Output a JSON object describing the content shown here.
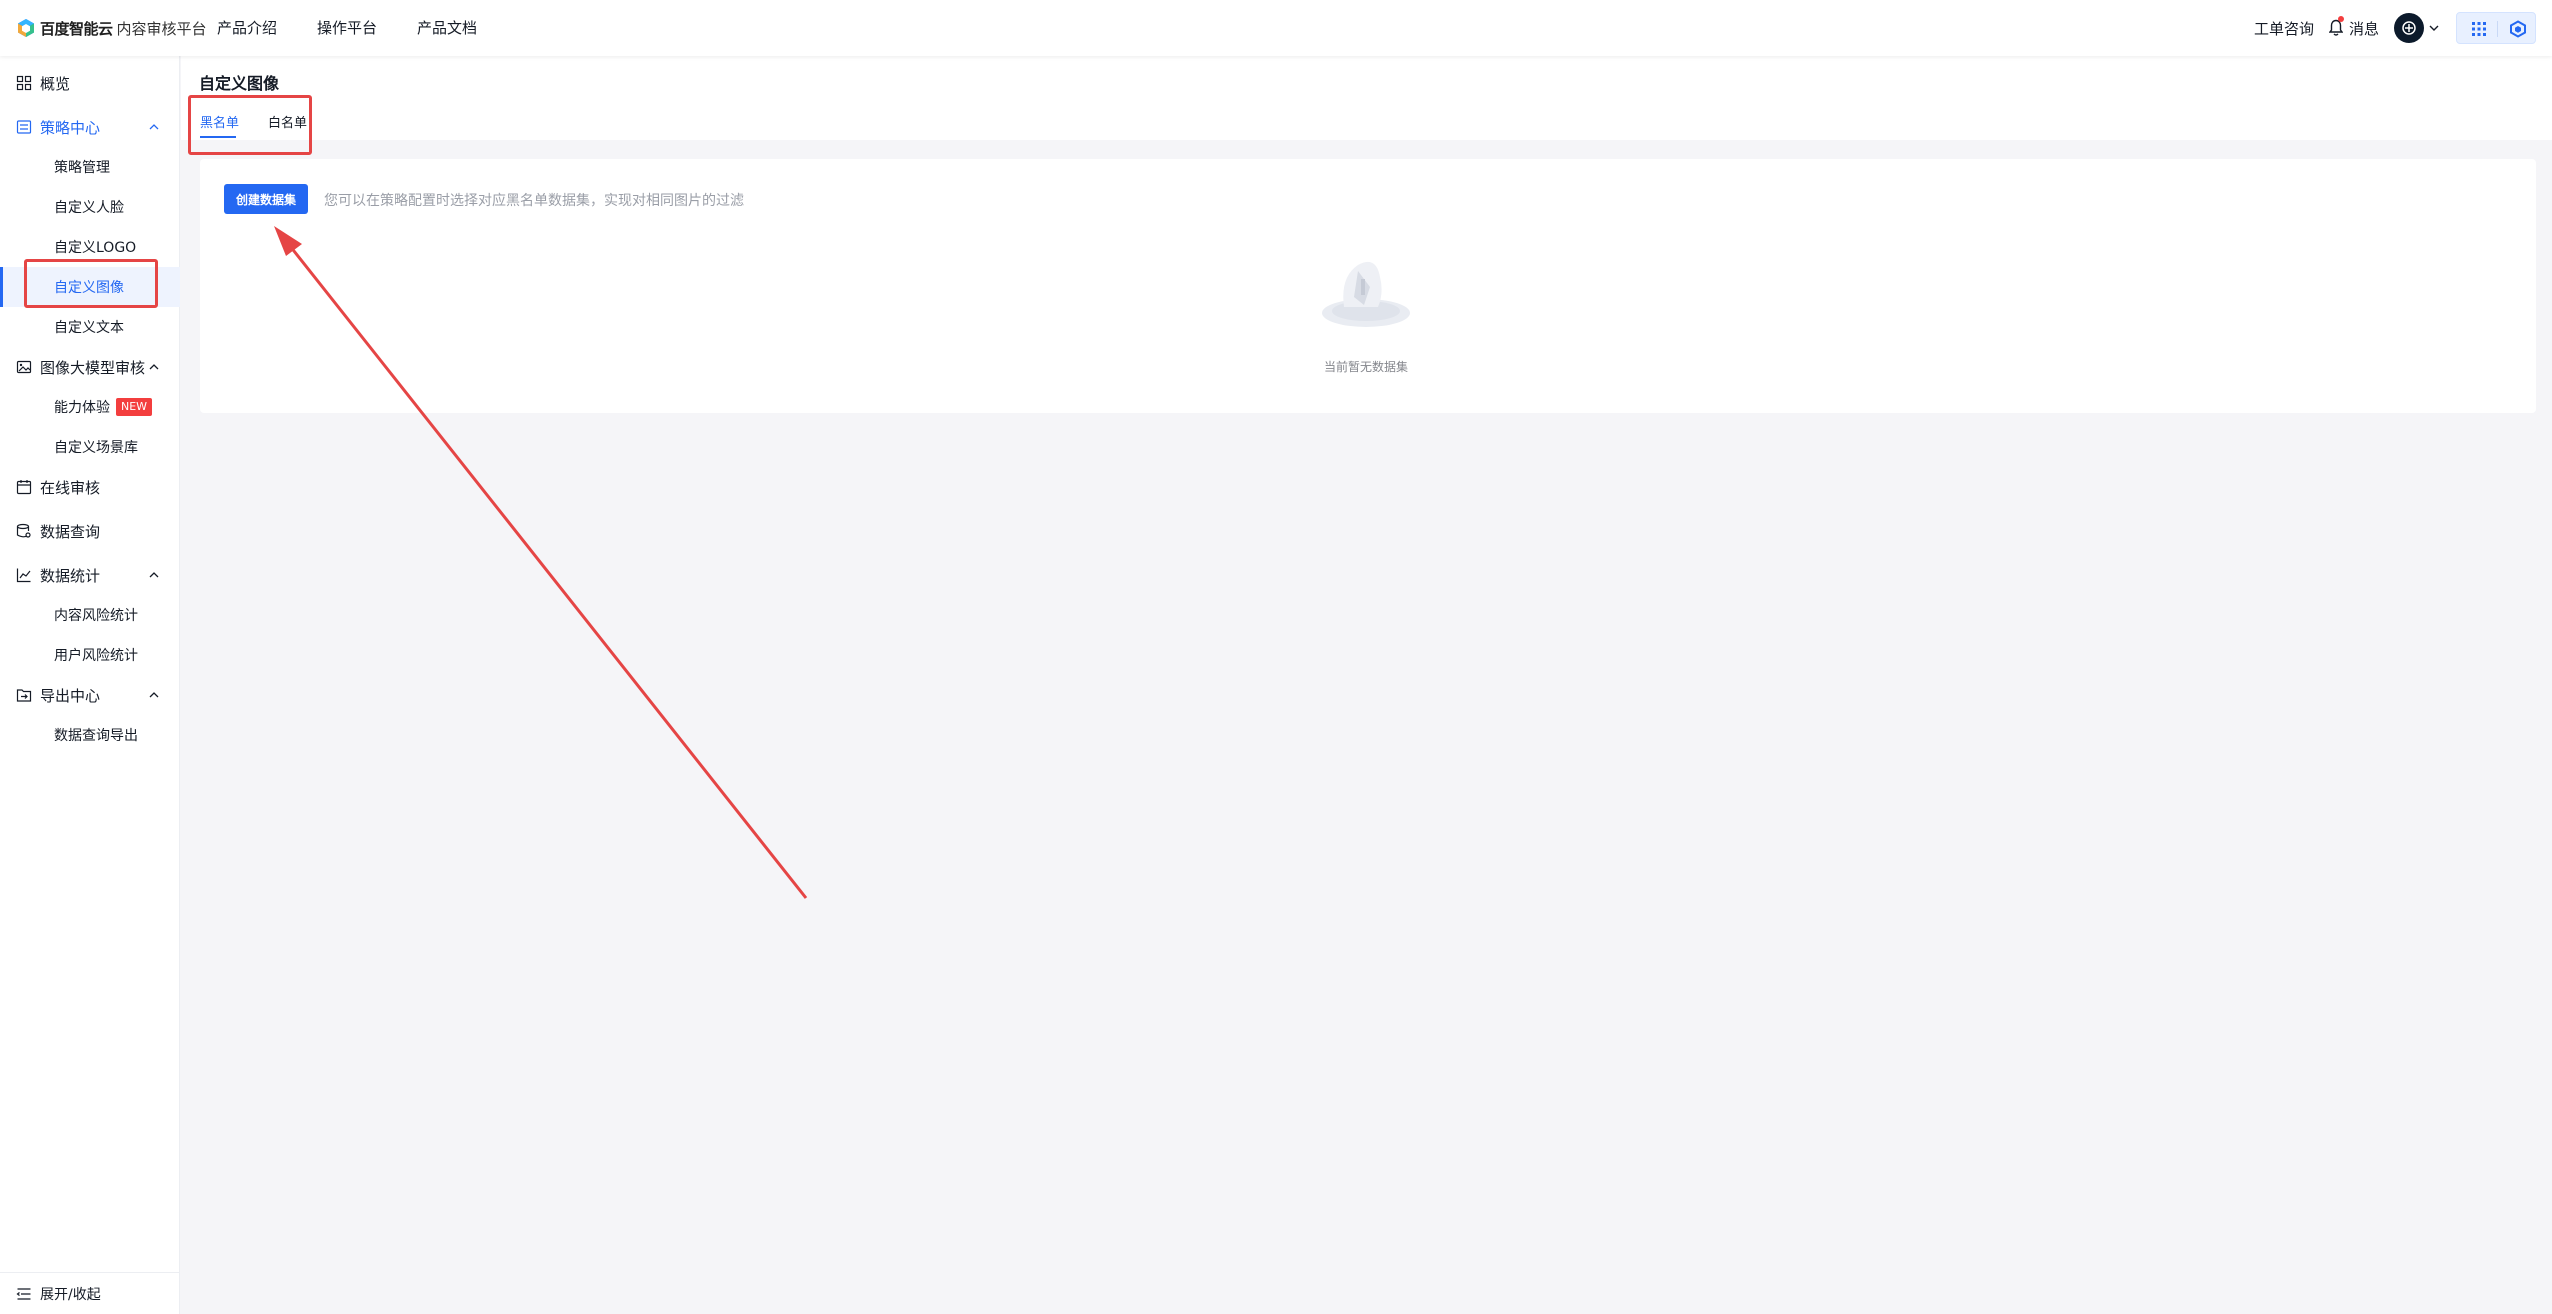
{
  "brand": {
    "name": "百度智能云",
    "product": "内容审核平台"
  },
  "topnav": [
    "产品介绍",
    "操作平台",
    "产品文档"
  ],
  "top_right": {
    "ticket": "工单咨询",
    "messages": "消息"
  },
  "sidebar": {
    "overview": "概览",
    "strategy_center": "策略中心",
    "strategy_children": [
      "策略管理",
      "自定义人脸",
      "自定义LOGO",
      "自定义图像",
      "自定义文本"
    ],
    "image_model": "图像大模型审核",
    "image_model_children": [
      "能力体验",
      "自定义场景库"
    ],
    "new_badge": "NEW",
    "online_review": "在线审核",
    "data_query": "数据查询",
    "data_stats": "数据统计",
    "stats_children": [
      "内容风险统计",
      "用户风险统计"
    ],
    "export_center": "导出中心",
    "export_children": [
      "数据查询导出"
    ],
    "collapse": "展开/收起"
  },
  "page": {
    "title": "自定义图像",
    "tabs": [
      "黑名单",
      "白名单"
    ],
    "active_tab": "黑名单"
  },
  "card": {
    "create_button": "创建数据集",
    "hint": "您可以在策略配置时选择对应黑名单数据集，实现对相同图片的过滤",
    "empty_text": "当前暂无数据集"
  },
  "colors": {
    "accent": "#2468f2",
    "annotation": "#e54545",
    "badge": "#f33e3e"
  }
}
